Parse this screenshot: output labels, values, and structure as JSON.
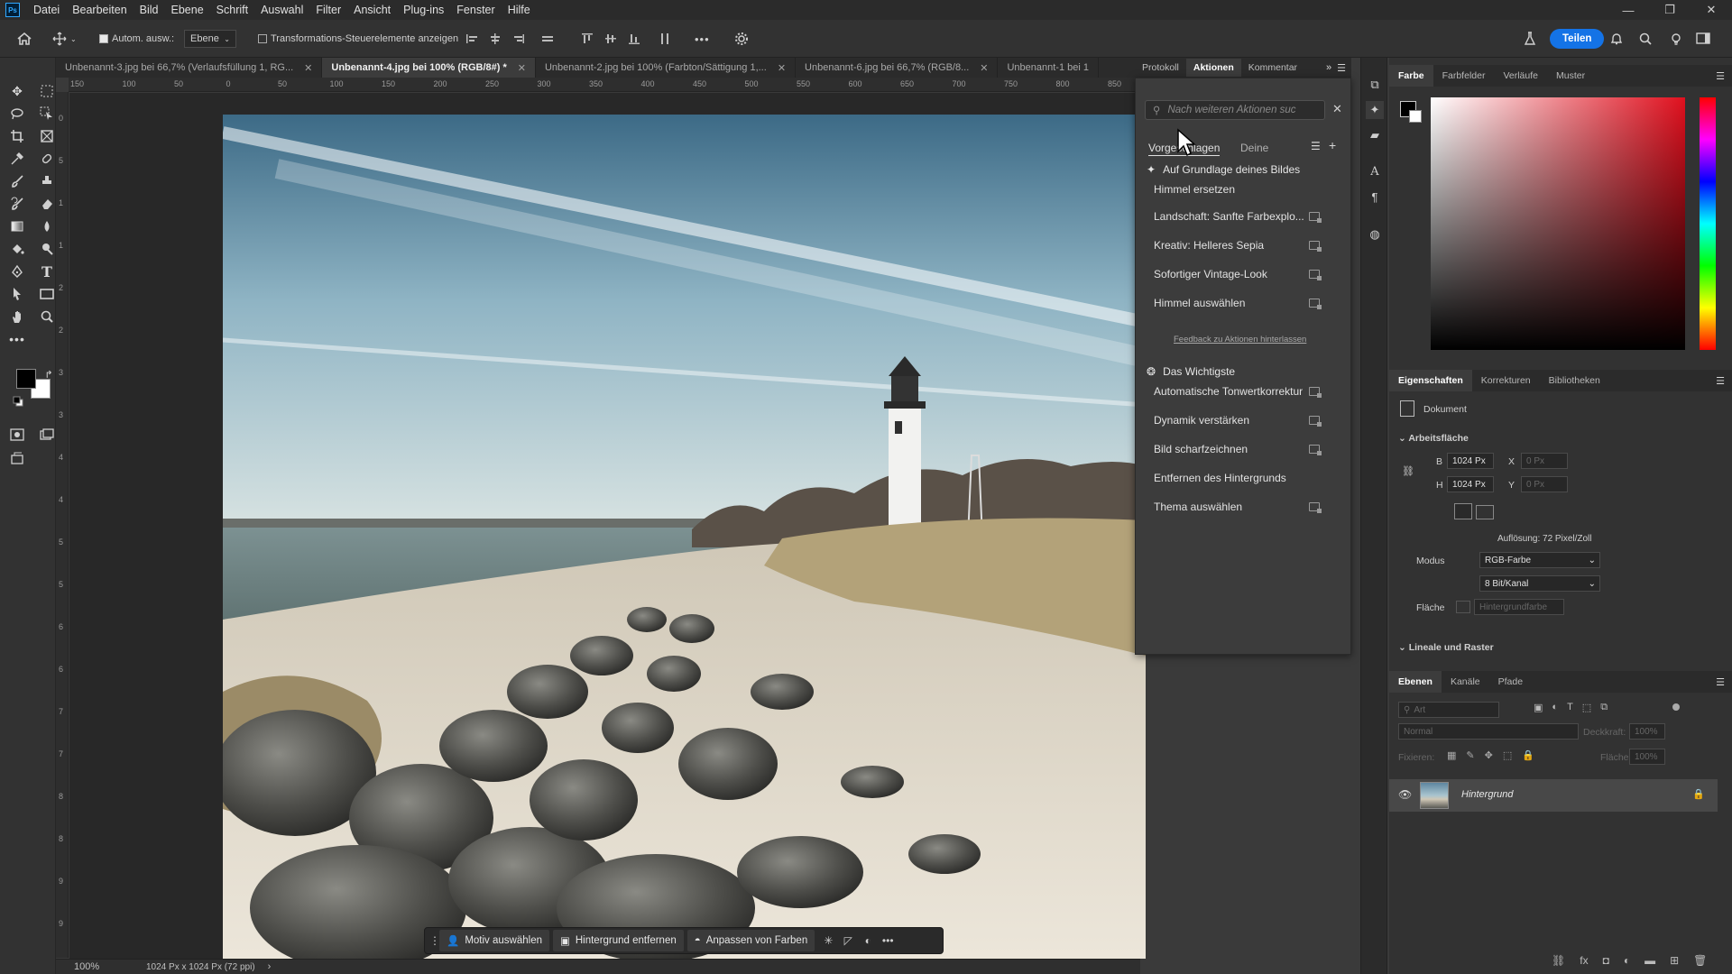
{
  "menu": [
    "Datei",
    "Bearbeiten",
    "Bild",
    "Ebene",
    "Schrift",
    "Auswahl",
    "Filter",
    "Ansicht",
    "Plug-ins",
    "Fenster",
    "Hilfe"
  ],
  "app_logo": "Ps",
  "window": {
    "minimize": "—",
    "restore": "❐",
    "close": "✕"
  },
  "options": {
    "auto_select_label": "Autom. ausw.:",
    "auto_select_target": "Ebene",
    "transform_controls": "Transformations-Steuerelemente anzeigen",
    "more": "•••",
    "share": "Teilen"
  },
  "tabs": [
    {
      "label": "Unbenannt-3.jpg bei 66,7% (Verlaufsfüllung 1, RG...",
      "active": false
    },
    {
      "label": "Unbenannt-4.jpg bei 100% (RGB/8#) *",
      "active": true
    },
    {
      "label": "Unbenannt-2.jpg bei 100% (Farbton/Sättigung 1,...",
      "active": false
    },
    {
      "label": "Unbenannt-6.jpg bei 66,7% (RGB/8...",
      "active": false
    },
    {
      "label": "Unbenannt-1 bei 1",
      "active": false
    }
  ],
  "ruler_h": [
    "150",
    "100",
    "50",
    "0",
    "50",
    "100",
    "150",
    "200",
    "250",
    "300",
    "350",
    "400",
    "450",
    "500",
    "550",
    "600",
    "650",
    "700",
    "750",
    "800",
    "850"
  ],
  "ruler_v": [
    "0",
    "5",
    "1",
    "1",
    "2",
    "2",
    "3",
    "3",
    "4",
    "4",
    "5",
    "5",
    "6",
    "6",
    "7",
    "7",
    "8",
    "8",
    "9",
    "9"
  ],
  "context_bar": {
    "select_subject": "Motiv auswählen",
    "remove_bg": "Hintergrund entfernen",
    "adjust_colors": "Anpassen von Farben",
    "more": "•••"
  },
  "status": {
    "zoom": "100%",
    "doc_size": "1024 Px x 1024 Px (72 ppi)"
  },
  "actions_panel": {
    "tabs": [
      "Protokoll",
      "Aktionen",
      "Kommentar"
    ],
    "active_tab": "Aktionen",
    "search_placeholder": "Nach weiteren Aktionen suc",
    "subtabs": [
      "Vorgeschlagen",
      "Deine"
    ],
    "section1_title": "Auf Grundlage deines Bildes",
    "section1_items": [
      "Himmel ersetzen",
      "Landschaft: Sanfte Farbexplo...",
      "Kreativ: Helleres Sepia",
      "Sofortiger Vintage-Look",
      "Himmel auswählen"
    ],
    "feedback_link": "Feedback zu Aktionen hinterlassen",
    "section2_title": "Das Wichtigste",
    "section2_items": [
      "Automatische Tonwertkorrektur",
      "Dynamik verstärken",
      "Bild scharfzeichnen",
      "Entfernen des Hintergrunds",
      "Thema auswählen"
    ]
  },
  "color_panel": {
    "tabs": [
      "Farbe",
      "Farbfelder",
      "Verläufe",
      "Muster"
    ],
    "active": "Farbe",
    "base_color": "#e0101e"
  },
  "properties_panel": {
    "tabs": [
      "Eigenschaften",
      "Korrekturen",
      "Bibliotheken"
    ],
    "doc_label": "Dokument",
    "artboard_title": "Arbeitsfläche",
    "w_label": "B",
    "w_value": "1024 Px",
    "h_label": "H",
    "h_value": "1024 Px",
    "x_label": "X",
    "x_value": "0 Px",
    "y_label": "Y",
    "y_value": "0 Px",
    "resolution": "Auflösung: 72 Pixel/Zoll",
    "mode_label": "Modus",
    "mode_value": "RGB-Farbe",
    "depth_value": "8 Bit/Kanal",
    "fill_label": "Fläche",
    "fill_value": "Hintergrundfarbe",
    "rulers_title": "Lineale und Raster"
  },
  "layers_panel": {
    "tabs": [
      "Ebenen",
      "Kanäle",
      "Pfade"
    ],
    "search_placeholder": "Art",
    "blend_mode": "Normal",
    "opacity_label": "Deckkraft:",
    "opacity_value": "100%",
    "lock_label": "Fixieren:",
    "fill_label": "Fläche:",
    "fill_value": "100%",
    "layer_name": "Hintergrund"
  }
}
